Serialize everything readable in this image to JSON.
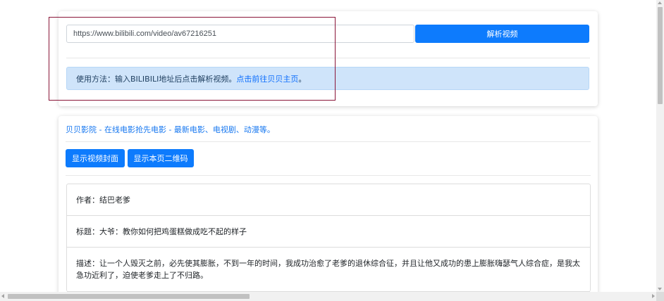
{
  "parser": {
    "url_value": "https://www.bilibili.com/video/av67216251",
    "parse_button_label": "解析视频"
  },
  "usage": {
    "text": "使用方法：输入BILIBILI地址后点击解析视频。",
    "link_text": "点击前往贝贝主页",
    "suffix": "。"
  },
  "site": {
    "link_text": "贝贝影院 - 在线电影抢先电影 - 最新电影、电视剧、动漫等。"
  },
  "actions": {
    "show_cover_label": "显示视频封面",
    "show_qr_label": "显示本页二维码"
  },
  "video_info": {
    "author": "作者：结巴老爹",
    "title": "标题：大爷：教你如何把鸡蛋糕做成吃不起的样子",
    "description": "描述：让一个人毁灭之前，必先使其膨胀，不到一年的时间，我成功治愈了老爹的退休综合征，并且让他又成功的患上膨胀嗨瑟气人综合症，是我太急功近利了，迫使老爹走上了不归路。"
  },
  "colors": {
    "primary": "#0d7bfd",
    "alert_bg": "#cfe4fa",
    "highlight": "#8a1538",
    "link": "#1878f0"
  }
}
